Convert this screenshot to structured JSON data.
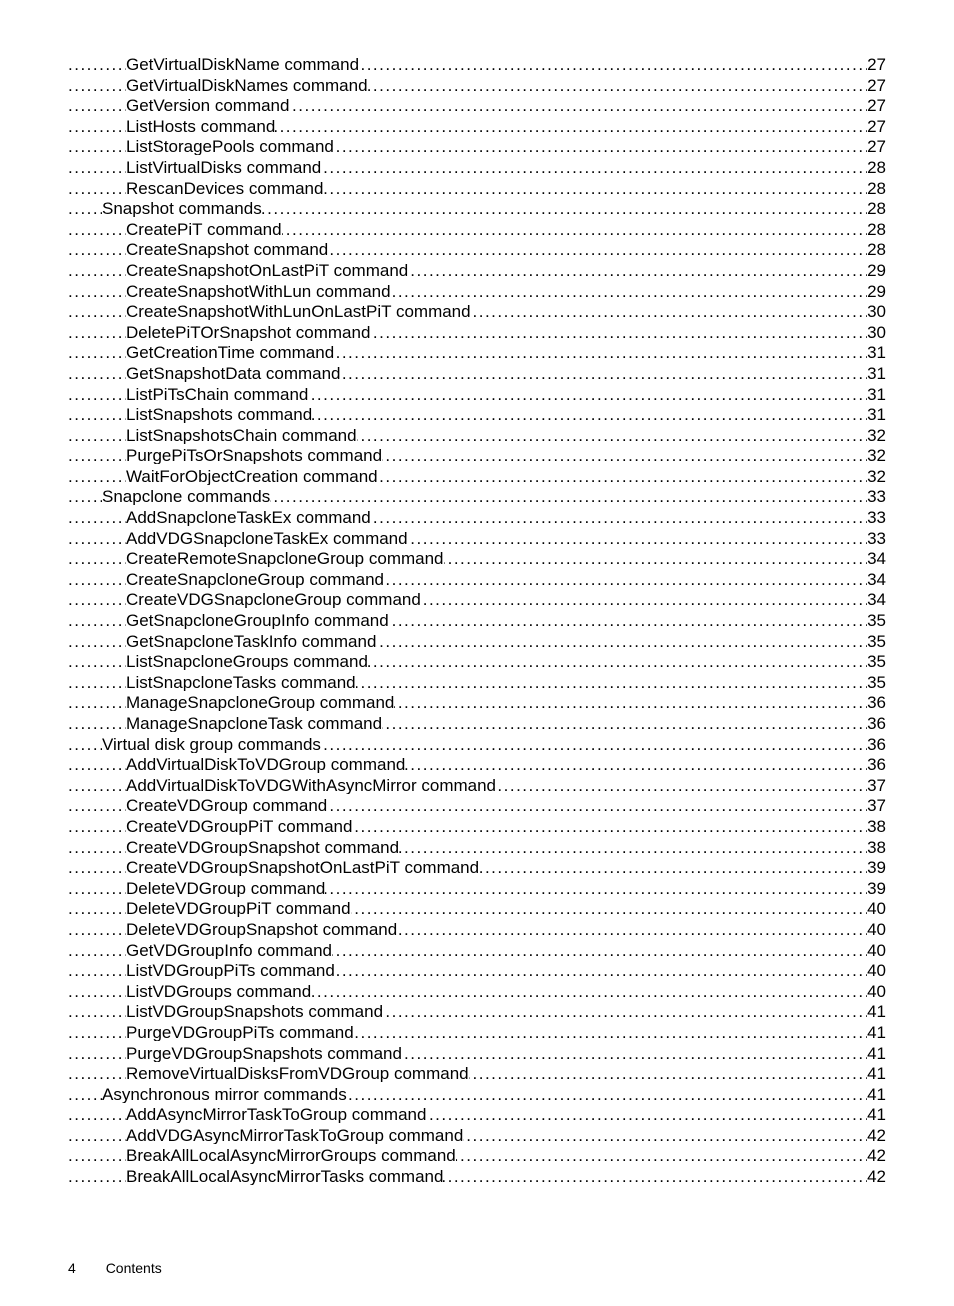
{
  "toc": [
    {
      "label": "GetVirtualDiskName command",
      "page": "27",
      "indent": 3
    },
    {
      "label": "GetVirtualDiskNames command",
      "page": "27",
      "indent": 3
    },
    {
      "label": "GetVersion command",
      "page": "27",
      "indent": 3
    },
    {
      "label": "ListHosts command",
      "page": "27",
      "indent": 3
    },
    {
      "label": "ListStoragePools command",
      "page": "27",
      "indent": 3
    },
    {
      "label": "ListVirtualDisks command",
      "page": "28",
      "indent": 3
    },
    {
      "label": "RescanDevices command",
      "page": "28",
      "indent": 3
    },
    {
      "label": "Snapshot commands",
      "page": "28",
      "indent": 2
    },
    {
      "label": "CreatePiT command",
      "page": "28",
      "indent": 3
    },
    {
      "label": "CreateSnapshot command",
      "page": "28",
      "indent": 3
    },
    {
      "label": "CreateSnapshotOnLastPiT command",
      "page": "29",
      "indent": 3
    },
    {
      "label": "CreateSnapshotWithLun command",
      "page": "29",
      "indent": 3
    },
    {
      "label": "CreateSnapshotWithLunOnLastPiT command",
      "page": "30",
      "indent": 3
    },
    {
      "label": "DeletePiTOrSnapshot command",
      "page": "30",
      "indent": 3
    },
    {
      "label": "GetCreationTime command",
      "page": "31",
      "indent": 3
    },
    {
      "label": "GetSnapshotData command",
      "page": "31",
      "indent": 3
    },
    {
      "label": "ListPiTsChain command",
      "page": "31",
      "indent": 3
    },
    {
      "label": "ListSnapshots command",
      "page": "31",
      "indent": 3
    },
    {
      "label": "ListSnapshotsChain command",
      "page": "32",
      "indent": 3
    },
    {
      "label": "PurgePiTsOrSnapshots command",
      "page": "32",
      "indent": 3
    },
    {
      "label": "WaitForObjectCreation command",
      "page": "32",
      "indent": 3
    },
    {
      "label": "Snapclone commands",
      "page": "33",
      "indent": 2
    },
    {
      "label": "AddSnapcloneTaskEx command",
      "page": "33",
      "indent": 3
    },
    {
      "label": "AddVDGSnapcloneTaskEx command",
      "page": "33",
      "indent": 3
    },
    {
      "label": "CreateRemoteSnapcloneGroup command",
      "page": "34",
      "indent": 3
    },
    {
      "label": "CreateSnapcloneGroup command",
      "page": "34",
      "indent": 3
    },
    {
      "label": "CreateVDGSnapcloneGroup command",
      "page": "34",
      "indent": 3
    },
    {
      "label": "GetSnapcloneGroupInfo command",
      "page": "35",
      "indent": 3
    },
    {
      "label": "GetSnapcloneTaskInfo command",
      "page": "35",
      "indent": 3
    },
    {
      "label": "ListSnapcloneGroups command",
      "page": "35",
      "indent": 3
    },
    {
      "label": "ListSnapcloneTasks command",
      "page": "35",
      "indent": 3
    },
    {
      "label": "ManageSnapcloneGroup command",
      "page": "36",
      "indent": 3
    },
    {
      "label": "ManageSnapcloneTask command",
      "page": "36",
      "indent": 3
    },
    {
      "label": "Virtual disk group commands",
      "page": "36",
      "indent": 2
    },
    {
      "label": "AddVirtualDiskToVDGroup command",
      "page": "36",
      "indent": 3
    },
    {
      "label": "AddVirtualDiskToVDGWithAsyncMirror command",
      "page": "37",
      "indent": 3
    },
    {
      "label": "CreateVDGroup command",
      "page": "37",
      "indent": 3
    },
    {
      "label": "CreateVDGroupPiT command",
      "page": "38",
      "indent": 3
    },
    {
      "label": "CreateVDGroupSnapshot command",
      "page": "38",
      "indent": 3
    },
    {
      "label": "CreateVDGroupSnapshotOnLastPiT command",
      "page": "39",
      "indent": 3
    },
    {
      "label": "DeleteVDGroup command",
      "page": "39",
      "indent": 3
    },
    {
      "label": "DeleteVDGroupPiT command",
      "page": "40",
      "indent": 3
    },
    {
      "label": "DeleteVDGroupSnapshot command",
      "page": "40",
      "indent": 3
    },
    {
      "label": "GetVDGroupInfo command",
      "page": "40",
      "indent": 3
    },
    {
      "label": "ListVDGroupPiTs command",
      "page": "40",
      "indent": 3
    },
    {
      "label": "ListVDGroups command",
      "page": "40",
      "indent": 3
    },
    {
      "label": "ListVDGroupSnapshots command",
      "page": "41",
      "indent": 3
    },
    {
      "label": "PurgeVDGroupPiTs command",
      "page": "41",
      "indent": 3
    },
    {
      "label": "PurgeVDGroupSnapshots command",
      "page": "41",
      "indent": 3
    },
    {
      "label": "RemoveVirtualDisksFromVDGroup command",
      "page": "41",
      "indent": 3
    },
    {
      "label": "Asynchronous mirror commands",
      "page": "41",
      "indent": 2
    },
    {
      "label": "AddAsyncMirrorTaskToGroup command",
      "page": "41",
      "indent": 3
    },
    {
      "label": "AddVDGAsyncMirrorTaskToGroup command",
      "page": "42",
      "indent": 3
    },
    {
      "label": "BreakAllLocalAsyncMirrorGroups command",
      "page": "42",
      "indent": 3
    },
    {
      "label": "BreakAllLocalAsyncMirrorTasks command",
      "page": "42",
      "indent": 3
    }
  ],
  "footer": {
    "page_number": "4",
    "section": "Contents"
  }
}
